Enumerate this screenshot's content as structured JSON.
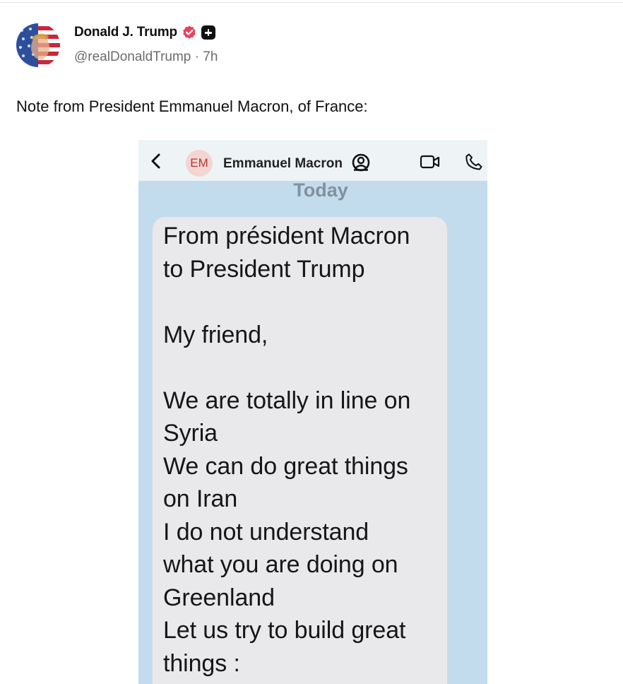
{
  "post": {
    "author_name": "Donald J. Trump",
    "handle": "@realDonaldTrump",
    "separator": "·",
    "time_ago": "7h",
    "text": "Note from President Emmanuel Macron, of France:",
    "icons": [
      "avatar",
      "verified-badge-icon",
      "plus-badge-icon"
    ]
  },
  "screenshot": {
    "contact_initials": "EM",
    "contact_name": "Emmanuel Macron",
    "day_label": "Today",
    "message": "From président Macron\nto President Trump\n\nMy friend,\n\nWe are totally in line on\nSyria\nWe can do great things\non Iran\nI do not understand\nwhat you are doing on\nGreenland\nLet us try to build great\nthings :",
    "icons": [
      "back-chevron-icon",
      "contact-info-icon",
      "video-call-icon",
      "phone-call-icon"
    ]
  },
  "colors": {
    "verified": "#e8435c",
    "chat_background": "#c2dced",
    "bubble": "#e9e9eb"
  }
}
